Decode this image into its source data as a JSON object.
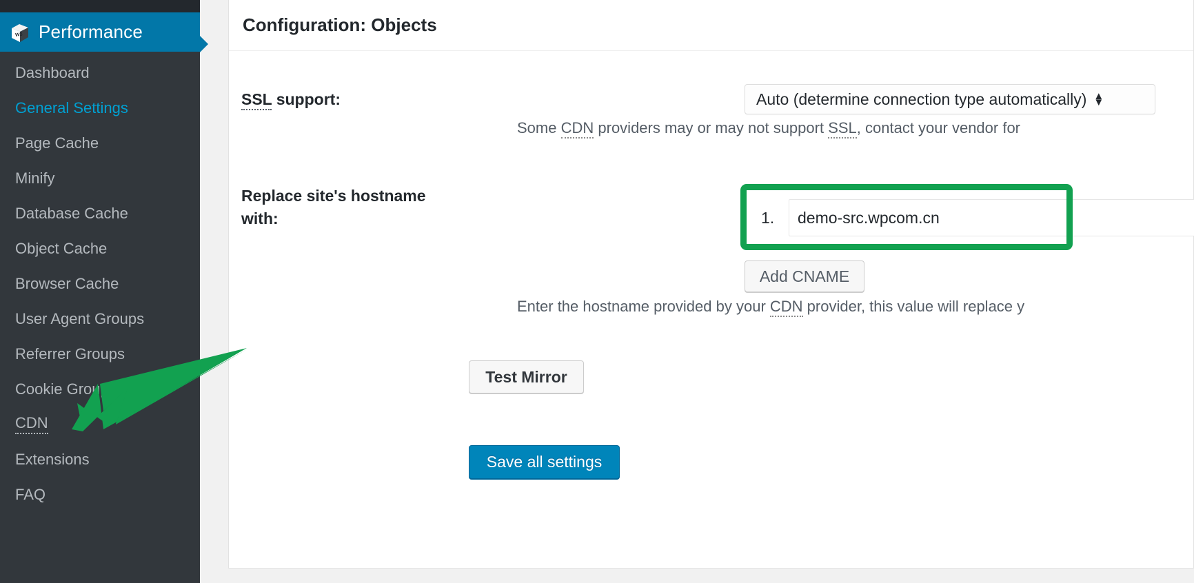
{
  "sidebar": {
    "brand": {
      "label": "Performance",
      "icon": "w3-cube-logo"
    },
    "items": [
      {
        "label": "Dashboard",
        "active": false,
        "abbr": false
      },
      {
        "label": "General Settings",
        "active": true,
        "abbr": false
      },
      {
        "label": "Page Cache",
        "active": false,
        "abbr": false
      },
      {
        "label": "Minify",
        "active": false,
        "abbr": false
      },
      {
        "label": "Database Cache",
        "active": false,
        "abbr": false
      },
      {
        "label": "Object Cache",
        "active": false,
        "abbr": false
      },
      {
        "label": "Browser Cache",
        "active": false,
        "abbr": false
      },
      {
        "label": "User Agent Groups",
        "active": false,
        "abbr": false
      },
      {
        "label": "Referrer Groups",
        "active": false,
        "abbr": false
      },
      {
        "label": "Cookie Groups",
        "active": false,
        "abbr": false
      },
      {
        "label": "CDN",
        "active": false,
        "abbr": true
      },
      {
        "label": "Extensions",
        "active": false,
        "abbr": false
      },
      {
        "label": "FAQ",
        "active": false,
        "abbr": false
      }
    ]
  },
  "panel": {
    "title": "Configuration: Objects",
    "ssl": {
      "label_abbr": "SSL",
      "label_rest": " support:",
      "selected_option": "Auto (determine connection type automatically)",
      "options": [
        "Auto (determine connection type automatically)"
      ],
      "help_pre": "Some ",
      "help_abbr1": "CDN",
      "help_mid": " providers may or may not support ",
      "help_abbr2": "SSL",
      "help_post": ", contact your vendor for"
    },
    "hostname": {
      "label_line1": "Replace site's hostname",
      "label_line2": "with:",
      "index": "1.",
      "value": "demo-src.wpcom.cn",
      "placeholder": "",
      "add_button": "Add CNAME",
      "help_pre": "Enter the hostname provided by your ",
      "help_abbr": "CDN",
      "help_post": " provider, this value will replace y"
    },
    "test_mirror_button": "Test Mirror",
    "save_button": "Save all settings"
  },
  "annotations": {
    "highlight_color": "#12a150",
    "arrow_color": "#12a150",
    "arrow_target": "CDN"
  },
  "colors": {
    "sidebar_bg": "#32373c",
    "brand_bg": "#0277a8",
    "accent_link": "#00a0d2",
    "save_button": "#0085ba"
  }
}
